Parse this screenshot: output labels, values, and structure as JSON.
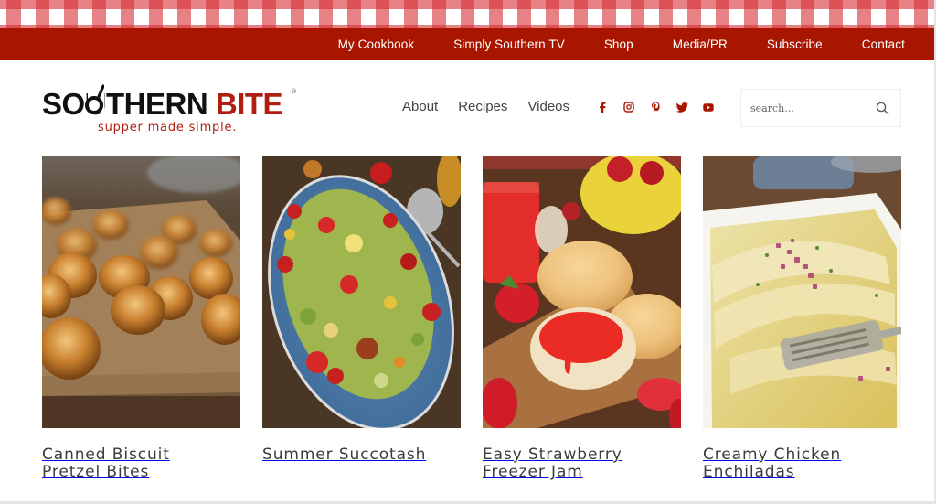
{
  "top_nav": {
    "items": [
      "My Cookbook",
      "Simply Southern TV",
      "Shop",
      "Media/PR",
      "Subscribe",
      "Contact"
    ]
  },
  "logo": {
    "word_black": "SOUTHERN",
    "word_red": "BITE",
    "registered": "®",
    "tagline": "supper made simple.",
    "icon": "skillet-icon"
  },
  "main_nav": {
    "items": [
      "About",
      "Recipes",
      "Videos"
    ]
  },
  "social": {
    "icons": [
      "facebook-icon",
      "instagram-icon",
      "pinterest-icon",
      "twitter-icon",
      "youtube-icon"
    ]
  },
  "search": {
    "placeholder": "search...",
    "value": "",
    "icon": "search-icon"
  },
  "recipes": [
    {
      "title": "Canned Biscuit Pretzel Bites",
      "image": "pretzel-bites-photo"
    },
    {
      "title": "Summer Succotash",
      "image": "succotash-photo"
    },
    {
      "title": "Easy Strawberry Freezer Jam",
      "image": "strawberry-jam-photo"
    },
    {
      "title": "Creamy Chicken Enchiladas",
      "image": "enchiladas-photo"
    }
  ],
  "colors": {
    "brand_red": "#a81600",
    "logo_red": "#b01e10",
    "gingham": "#d6343c",
    "nav_text": "#444444",
    "title_text": "#3c3c3c"
  }
}
